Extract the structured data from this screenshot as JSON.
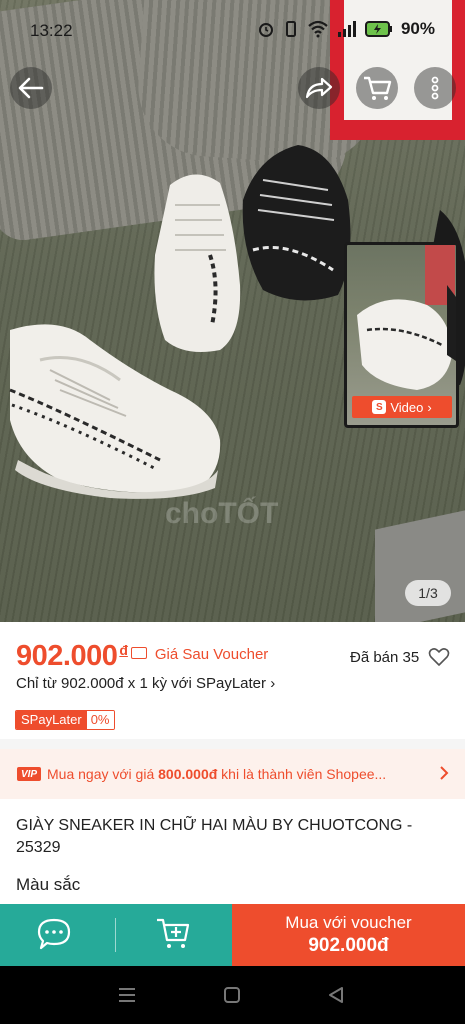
{
  "status_bar": {
    "time": "13:22",
    "battery": "90%"
  },
  "hero": {
    "watermark": "choTỐT",
    "image_counter": "1/3",
    "video_label": "Video"
  },
  "product": {
    "price": "902.000",
    "currency_symbol": "đ",
    "price_note": "Giá Sau Voucher",
    "sold": "Đã bán 35",
    "installment": "Chỉ từ 902.000đ x 1 kỳ với SPayLater",
    "installment_chevron": "›",
    "spaylater_label": "SPayLater",
    "spaylater_rate": "0%"
  },
  "vip_banner": {
    "badge": "VIP",
    "text_before": "Mua ngay với giá ",
    "text_price": "800.000đ",
    "text_after": " khi là thành viên Shopee..."
  },
  "title": "GIÀY SNEAKER IN CHỮ HAI MÀU BY CHUOTCONG - 25329",
  "color_label": "Màu sắc",
  "action_bar": {
    "buy_line1": "Mua với voucher",
    "buy_line2": "902.000đ"
  },
  "colors": {
    "accent": "#ee4d2d",
    "chat_green": "#26aa99",
    "vip_bg": "#fdf1ec"
  },
  "icons": [
    "back-arrow-icon",
    "share-icon",
    "cart-icon",
    "more-icon",
    "heart-icon",
    "chat-icon",
    "add-to-cart-icon",
    "shopee-logo-icon"
  ]
}
